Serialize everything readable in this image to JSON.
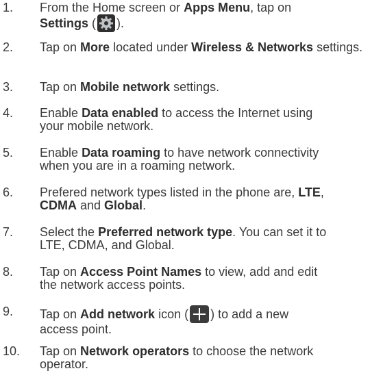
{
  "icons": {
    "settings": "settings-gear-icon",
    "add": "plus-icon"
  },
  "steps": [
    {
      "num": "1.",
      "parts": [
        {
          "t": "From the Home screen or "
        },
        {
          "b": "Apps Menu"
        },
        {
          "t": ", tap on "
        },
        {
          "br": true
        },
        {
          "b": "Settings"
        },
        {
          "t": " ("
        },
        {
          "icon": "settings"
        },
        {
          "t": ")."
        }
      ]
    },
    {
      "num": "2.",
      "parts": [
        {
          "t": "Tap on "
        },
        {
          "b": "More"
        },
        {
          "t": " located under "
        },
        {
          "b": "Wireless & Networks"
        },
        {
          "t": " settings."
        }
      ]
    },
    {
      "num": "3.",
      "parts": [
        {
          "t": "Tap on "
        },
        {
          "b": "Mobile network"
        },
        {
          "t": " settings."
        }
      ]
    },
    {
      "num": "4.",
      "parts": [
        {
          "t": "Enable "
        },
        {
          "b": "Data enabled"
        },
        {
          "t": " to access the Internet using "
        },
        {
          "br": true
        },
        {
          "t": "your mobile network."
        }
      ]
    },
    {
      "num": "5.",
      "parts": [
        {
          "t": "Enable "
        },
        {
          "b": "Data roaming"
        },
        {
          "t": " to have network connectivity "
        },
        {
          "br": true
        },
        {
          "t": "when you are in a roaming network."
        }
      ]
    },
    {
      "num": "6.",
      "parts": [
        {
          "t": "Prefered network types listed in the phone are, "
        },
        {
          "b": "LTE"
        },
        {
          "t": ", "
        },
        {
          "br": true
        },
        {
          "b": "CDMA"
        },
        {
          "t": " and "
        },
        {
          "b": "Global"
        },
        {
          "t": "."
        }
      ]
    },
    {
      "num": "7.",
      "parts": [
        {
          "t": "Select the "
        },
        {
          "b": "Preferred network type"
        },
        {
          "t": ". You can set it to "
        },
        {
          "br": true
        },
        {
          "t": "LTE, CDMA, and Global."
        }
      ]
    },
    {
      "num": "8.",
      "parts": [
        {
          "t": "Tap on "
        },
        {
          "b": "Access Point Names"
        },
        {
          "t": " to view, add and edit "
        },
        {
          "br": true
        },
        {
          "t": "the network access points."
        }
      ]
    },
    {
      "num": "9.",
      "parts": [
        {
          "t": "Tap on "
        },
        {
          "b": "Add network"
        },
        {
          "t": " icon ("
        },
        {
          "icon": "add"
        },
        {
          "t": ") to add a new "
        },
        {
          "br": true
        },
        {
          "t": "access point."
        }
      ]
    },
    {
      "num": "10.",
      "parts": [
        {
          "t": "Tap on "
        },
        {
          "b": "Network operators"
        },
        {
          "t": " to choose the network "
        },
        {
          "br": true
        },
        {
          "t": "operator."
        }
      ]
    }
  ]
}
